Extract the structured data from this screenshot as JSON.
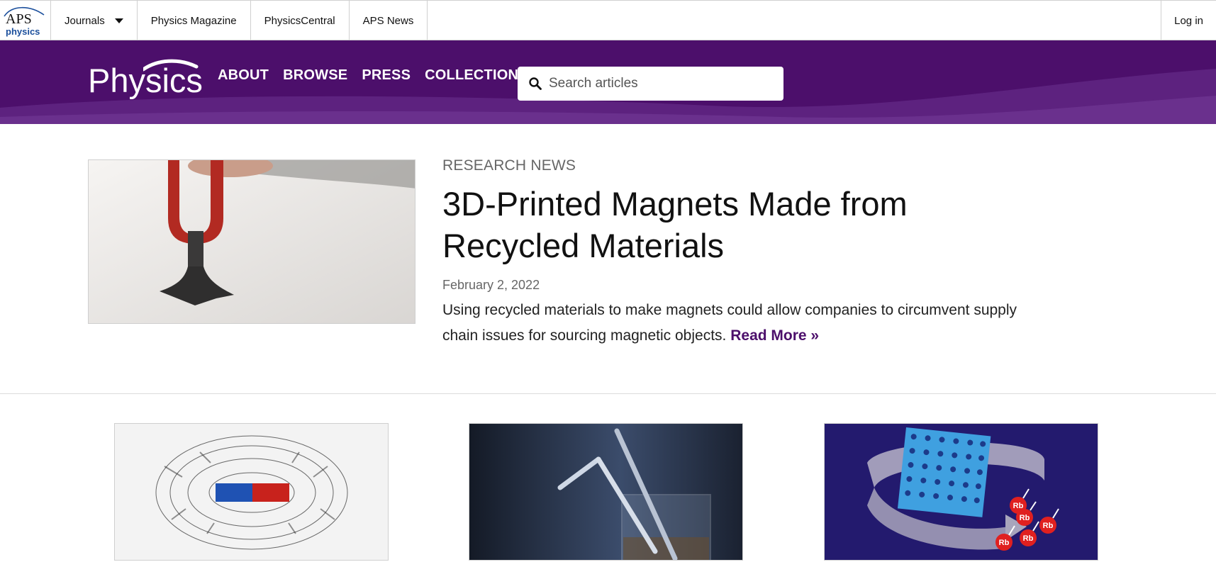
{
  "topbar": {
    "logo_text_top": "APS",
    "logo_text_bottom": "physics",
    "nav": [
      {
        "label": "Journals",
        "has_dropdown": true
      },
      {
        "label": "Physics Magazine"
      },
      {
        "label": "PhysicsCentral"
      },
      {
        "label": "APS News"
      }
    ],
    "login_label": "Log in"
  },
  "header": {
    "logo_text": "Physics",
    "nav": [
      "ABOUT",
      "BROWSE",
      "PRESS",
      "COLLECTIONS"
    ],
    "search_placeholder": "Search articles",
    "colors": {
      "background": "#4c0f6b",
      "wave": "#6b3390"
    }
  },
  "feature": {
    "kicker": "RESEARCH NEWS",
    "title": "3D-Printed Magnets Made from Recycled Materials",
    "date": "February 2, 2022",
    "summary": "Using recycled materials to make magnets could allow companies to circumvent supply chain issues for sourcing magnetic objects.",
    "read_more": "Read More »",
    "image_icon": "magnet-photo"
  },
  "cards": [
    {
      "image_icon": "bar-magnet-iron-filings-photo"
    },
    {
      "image_icon": "straws-in-glass-photo"
    },
    {
      "image_icon": "rubidium-lattice-illustration",
      "atom_label": "Rb"
    }
  ]
}
